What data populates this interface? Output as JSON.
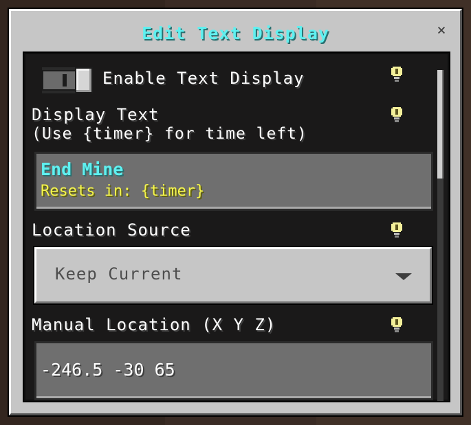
{
  "dialog": {
    "title": "Edit Text Display",
    "close_glyph": "×"
  },
  "toggle": {
    "label": "Enable Text Display",
    "state": "off",
    "info_icon": "info-bulb-icon"
  },
  "display_text": {
    "label_line1": "Display Text",
    "label_line2": "(Use {timer} for time left)",
    "value_line1": "End Mine",
    "value_line2": "Resets in: {timer}",
    "info_icon": "info-bulb-icon"
  },
  "location_source": {
    "label": "Location Source",
    "selected": "Keep Current",
    "info_icon": "info-bulb-icon"
  },
  "manual_location": {
    "label": "Manual Location (X Y Z)",
    "value": "-246.5 -30 65",
    "info_icon": "info-bulb-icon"
  },
  "colors": {
    "title": "#5ff0f0",
    "highlight_line": "#f6f64b",
    "panel_bg": "#1a1919",
    "dialog_bg": "#c6c6c6"
  }
}
